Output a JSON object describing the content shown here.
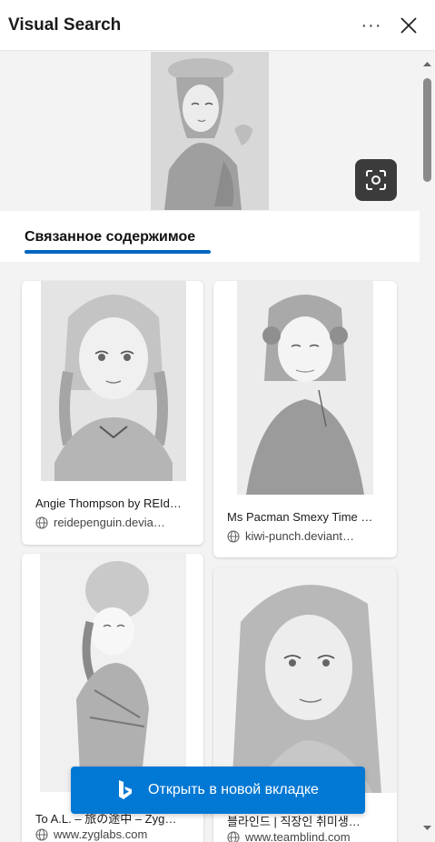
{
  "header": {
    "title": "Visual Search",
    "more_label": "···",
    "close_icon": "close-icon"
  },
  "hero": {
    "image_icon": "sketch-portrait-image",
    "visual_search_icon": "visual-search-icon"
  },
  "tabs": {
    "active_label": "Связанное содержимое",
    "accent_color": "#0067c0"
  },
  "results": [
    {
      "title": "Angie Thompson by REId…",
      "source": "reidepenguin.devia…"
    },
    {
      "title": "Ms Pacman Smexy Time …",
      "source": "kiwi-punch.deviant…"
    },
    {
      "title": "To A.L. – 旅の途中 – Zyg…",
      "source": "www.zyglabs.com"
    },
    {
      "title": "블라인드 | 직장인 취미생…",
      "source": "www.teamblind.com"
    }
  ],
  "open_button": {
    "label": "Открыть в новой вкладке",
    "icon": "bing-icon",
    "color": "#0078d4"
  },
  "scrollbar": {
    "up_icon": "scroll-up-arrow-icon",
    "down_icon": "scroll-down-arrow-icon"
  }
}
